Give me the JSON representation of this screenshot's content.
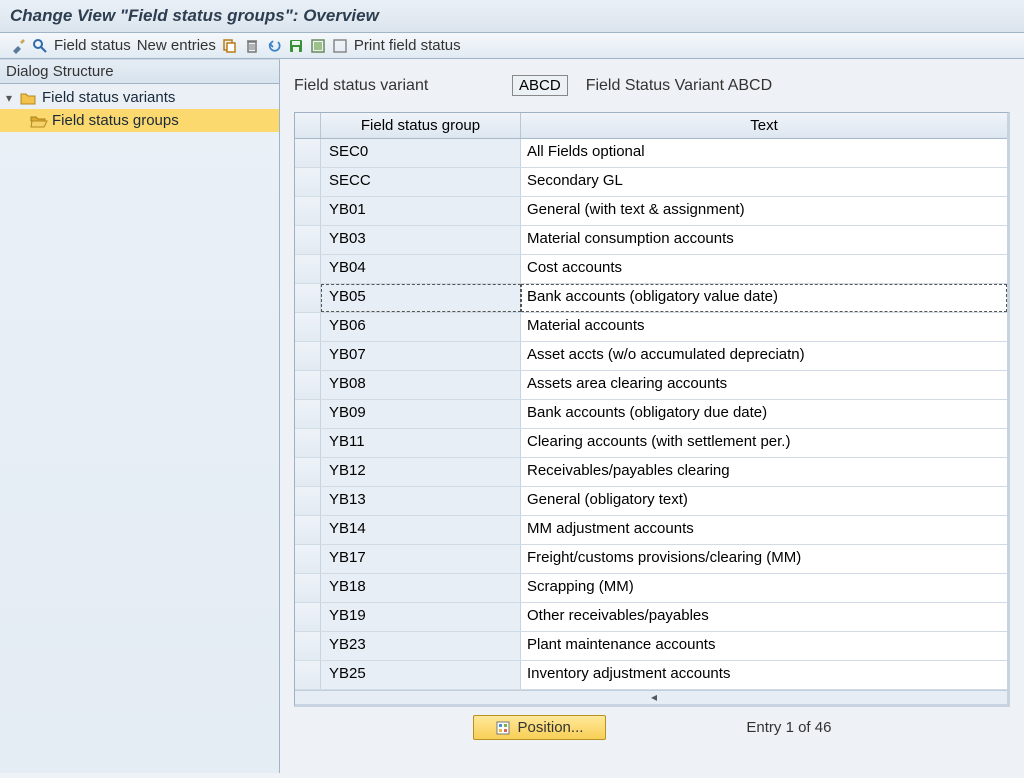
{
  "title": "Change View \"Field status groups\": Overview",
  "toolbar": {
    "field_status": "Field status",
    "new_entries": "New entries",
    "print_field_status": "Print field status"
  },
  "sidebar": {
    "header": "Dialog Structure",
    "items": [
      {
        "label": "Field status variants",
        "level": 1,
        "selected": false,
        "expanded": true
      },
      {
        "label": "Field status groups",
        "level": 2,
        "selected": true
      }
    ]
  },
  "fsv": {
    "label": "Field status variant",
    "value": "ABCD",
    "desc": "Field Status Variant ABCD"
  },
  "grid": {
    "headers": {
      "code": "Field status group",
      "text": "Text"
    },
    "rows": [
      {
        "code": "SEC0",
        "text": "All Fields optional"
      },
      {
        "code": "SECC",
        "text": "Secondary GL"
      },
      {
        "code": "YB01",
        "text": "General (with text & assignment)"
      },
      {
        "code": "YB03",
        "text": "Material consumption accounts"
      },
      {
        "code": "YB04",
        "text": "Cost accounts"
      },
      {
        "code": "YB05",
        "text": "Bank accounts (obligatory value date)",
        "focused": true
      },
      {
        "code": "YB06",
        "text": "Material accounts"
      },
      {
        "code": "YB07",
        "text": "Asset accts (w/o accumulated depreciatn)"
      },
      {
        "code": "YB08",
        "text": "Assets area clearing accounts"
      },
      {
        "code": "YB09",
        "text": "Bank accounts (obligatory due date)"
      },
      {
        "code": "YB11",
        "text": "Clearing accounts (with settlement per.)"
      },
      {
        "code": "YB12",
        "text": "Receivables/payables clearing"
      },
      {
        "code": "YB13",
        "text": "General (obligatory text)"
      },
      {
        "code": "YB14",
        "text": "MM adjustment accounts"
      },
      {
        "code": "YB17",
        "text": "Freight/customs provisions/clearing (MM)"
      },
      {
        "code": "YB18",
        "text": "Scrapping (MM)"
      },
      {
        "code": "YB19",
        "text": "Other receivables/payables"
      },
      {
        "code": "YB23",
        "text": "Plant maintenance accounts"
      },
      {
        "code": "YB25",
        "text": "Inventory adjustment accounts"
      }
    ]
  },
  "footer": {
    "position": "Position...",
    "entry_count": "Entry 1 of 46"
  }
}
